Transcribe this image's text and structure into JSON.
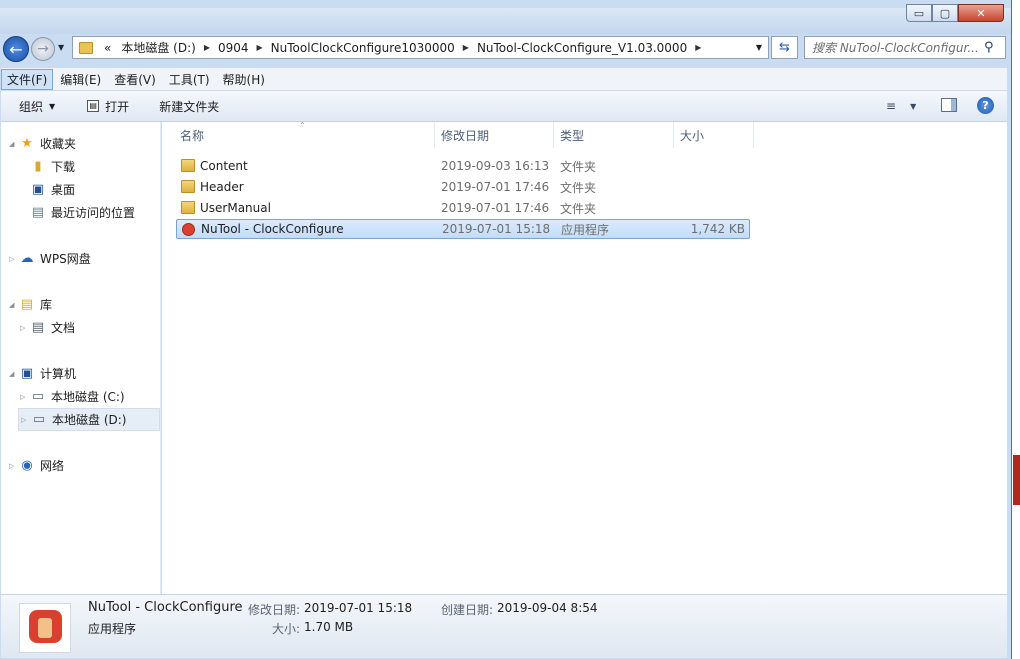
{
  "window": {
    "controls": {
      "minimize": "▭",
      "maximize": "▢",
      "close": "✕"
    }
  },
  "address": {
    "overflow": "«",
    "segments": [
      "本地磁盘 (D:)",
      "0904",
      "NuToolClockConfigure1030000",
      "NuTool-ClockConfigure_V1.03.0000"
    ]
  },
  "search": {
    "placeholder": "搜索 NuTool-ClockConfigur..."
  },
  "menu": [
    "文件(F)",
    "编辑(E)",
    "查看(V)",
    "工具(T)",
    "帮助(H)"
  ],
  "commands": {
    "organize": "组织",
    "open": "打开",
    "new_folder": "新建文件夹"
  },
  "nav": {
    "favorites": "收藏夹",
    "favorites_items": [
      "下载",
      "桌面",
      "最近访问的位置"
    ],
    "wps": "WPS网盘",
    "library": "库",
    "library_items": [
      "文档"
    ],
    "computer": "计算机",
    "computer_items": [
      "本地磁盘 (C:)",
      "本地磁盘 (D:)"
    ],
    "network": "网络"
  },
  "columns": {
    "name": "名称",
    "date": "修改日期",
    "type": "类型",
    "size": "大小"
  },
  "files": [
    {
      "name": "Content",
      "date": "2019-09-03 16:13",
      "type": "文件夹",
      "size": "",
      "icon": "folder-icon"
    },
    {
      "name": "Header",
      "date": "2019-07-01 17:46",
      "type": "文件夹",
      "size": "",
      "icon": "folder-icon"
    },
    {
      "name": "UserManual",
      "date": "2019-07-01 17:46",
      "type": "文件夹",
      "size": "",
      "icon": "folder-icon"
    },
    {
      "name": "NuTool - ClockConfigure",
      "date": "2019-07-01 15:18",
      "type": "应用程序",
      "size": "1,742 KB",
      "icon": "app-icon"
    }
  ],
  "details": {
    "name": "NuTool - ClockConfigure",
    "type": "应用程序",
    "modified_label": "修改日期:",
    "modified": "2019-07-01 15:18",
    "created_label": "创建日期:",
    "created": "2019-09-04 8:54",
    "size_label": "大小:",
    "size": "1.70 MB"
  },
  "colors": {
    "accent": "#3aa34a",
    "selection": "#c1dcfb",
    "frame": "#c9dcf1"
  }
}
